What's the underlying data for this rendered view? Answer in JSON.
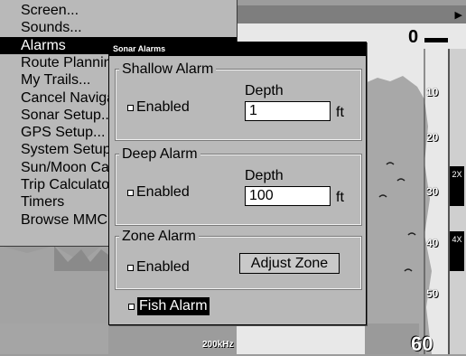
{
  "menu": {
    "items": [
      {
        "label": "Screen..."
      },
      {
        "label": "Sounds..."
      },
      {
        "label": "Alarms",
        "selected": true
      },
      {
        "label": "Route Planning..."
      },
      {
        "label": "My Trails..."
      },
      {
        "label": "Cancel Navigation"
      },
      {
        "label": "Sonar Setup..."
      },
      {
        "label": "GPS Setup..."
      },
      {
        "label": "System Setup..."
      },
      {
        "label": "Sun/Moon Calc..."
      },
      {
        "label": "Trip Calculator..."
      },
      {
        "label": "Timers"
      },
      {
        "label": "Browse MMC..."
      }
    ]
  },
  "sonar": {
    "depth_top": "0",
    "depth_ticks": [
      "10",
      "20",
      "30",
      "40",
      "50"
    ],
    "depth_bottom": "60",
    "zoom_badges": [
      "2X",
      "4X"
    ],
    "frequency": "200kHz",
    "colors": {
      "water": "#e8e8e8",
      "bottom": "#9c9c9c",
      "panel": "#b9b9b9"
    }
  },
  "dialog": {
    "title": "Sonar Alarms",
    "shallow": {
      "title": "Shallow Alarm",
      "enabled_label": "Enabled",
      "enabled": false,
      "depth_label": "Depth",
      "depth_value": "1",
      "unit": "ft"
    },
    "deep": {
      "title": "Deep Alarm",
      "enabled_label": "Enabled",
      "enabled": false,
      "depth_label": "Depth",
      "depth_value": "100",
      "unit": "ft"
    },
    "zone": {
      "title": "Zone Alarm",
      "enabled_label": "Enabled",
      "enabled": false,
      "adjust_label": "Adjust Zone"
    },
    "fish": {
      "label": "Fish Alarm",
      "enabled": false
    }
  }
}
